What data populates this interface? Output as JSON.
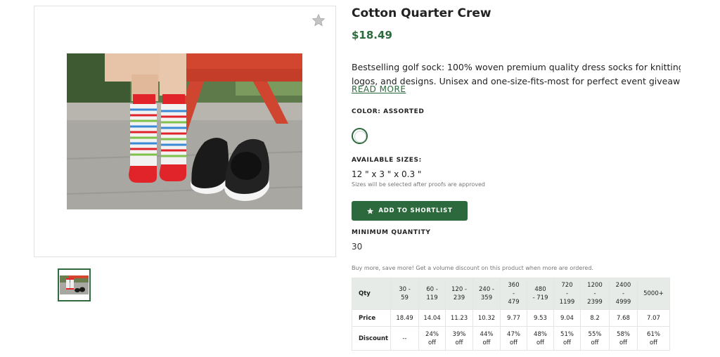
{
  "product": {
    "title": "Cotton Quarter Crew",
    "price": "$18.49",
    "description_lines": [
      "Bestselling golf sock: 100% woven premium quality dress socks for knitting complex",
      "logos, and designs. Unisex and one-size-fits-most for perfect event giveaways, swa..."
    ],
    "read_more": "READ MORE",
    "color_label": "COLOR: ASSORTED",
    "sizes_label": "AVAILABLE SIZES:",
    "size_value": "12 \" x 3 \" x 0.3 \"",
    "sizes_note": "Sizes will be selected after proofs are approved",
    "shortlist_button": "ADD TO SHORTLIST",
    "min_qty_label": "MINIMUM QUANTITY",
    "min_qty_value": "30",
    "volume_note": "Buy more, save more! Get a volume discount on this product when more are ordered."
  },
  "icons": {
    "favorite": "star-icon",
    "shortlist": "star-icon"
  },
  "colors": {
    "accent": "#2c6a3d",
    "table_header": "#e6ebe7"
  },
  "pricing_table": {
    "row_labels": {
      "qty": "Qty",
      "price": "Price",
      "discount": "Discount"
    },
    "qty": [
      [
        "30 -",
        "59"
      ],
      [
        "60 -",
        "119"
      ],
      [
        "120 -",
        "239"
      ],
      [
        "240 -",
        "359"
      ],
      [
        "360",
        "-",
        "479"
      ],
      [
        "480",
        "- 719"
      ],
      [
        "720",
        "-",
        "1199"
      ],
      [
        "1200",
        "-",
        "2399"
      ],
      [
        "2400",
        "-",
        "4999"
      ],
      [
        "5000+"
      ]
    ],
    "price": [
      "18.49",
      "14.04",
      "11.23",
      "10.32",
      "9.77",
      "9.53",
      "9.04",
      "8.2",
      "7.68",
      "7.07"
    ],
    "discount": [
      [
        "--"
      ],
      [
        "24%",
        "off"
      ],
      [
        "39%",
        "off"
      ],
      [
        "44%",
        "off"
      ],
      [
        "47%",
        "off"
      ],
      [
        "48%",
        "off"
      ],
      [
        "51%",
        "off"
      ],
      [
        "55%",
        "off"
      ],
      [
        "58%",
        "off"
      ],
      [
        "61%",
        "off"
      ]
    ]
  }
}
